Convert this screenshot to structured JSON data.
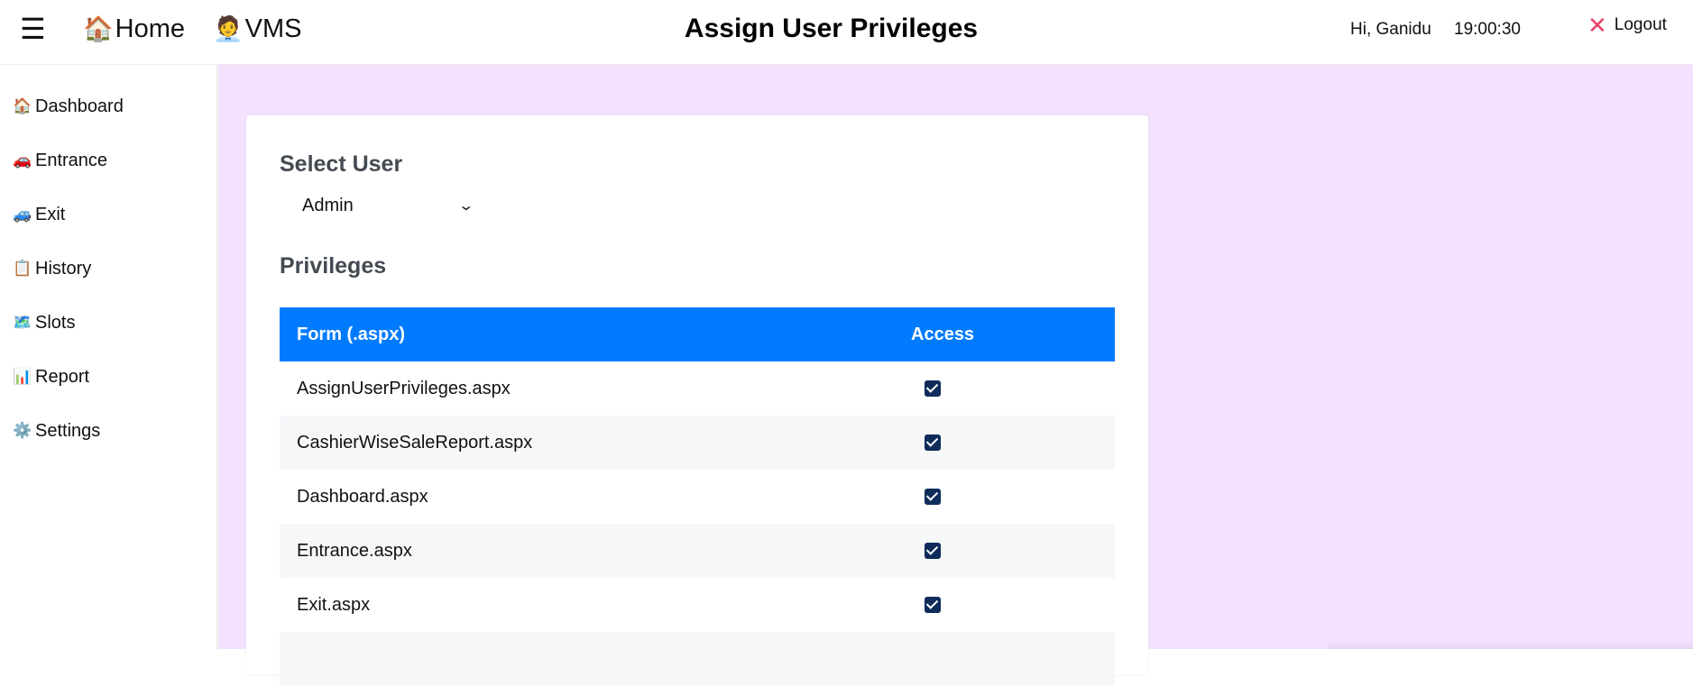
{
  "topbar": {
    "menu_icon": "☰",
    "home_icon": "🏠",
    "home_label": "Home",
    "vms_icon": "🧑‍💼",
    "vms_label": "VMS",
    "title": "Assign User Privileges",
    "greeting": "Hi, Ganidu",
    "clock": "19:00:30",
    "logout_icon": "✕",
    "logout_label": "Logout",
    "logout_icon_color": "#e8426b"
  },
  "sidebar": {
    "items": [
      {
        "icon": "🏠",
        "icon_name": "house-icon",
        "label": "Dashboard"
      },
      {
        "icon": "🚗",
        "icon_name": "car-icon",
        "label": "Entrance"
      },
      {
        "icon": "🚙",
        "icon_name": "suv-icon",
        "label": "Exit"
      },
      {
        "icon": "📋",
        "icon_name": "clipboard-icon",
        "label": "History"
      },
      {
        "icon": "🗺️",
        "icon_name": "map-icon",
        "label": "Slots"
      },
      {
        "icon": "📊",
        "icon_name": "bar-chart-icon",
        "label": "Report"
      },
      {
        "icon": "⚙️",
        "icon_name": "gear-icon",
        "label": "Settings"
      }
    ]
  },
  "main": {
    "background": "#f3e1fe",
    "select_user_title": "Select User",
    "selected_user": "Admin",
    "privileges_title": "Privileges",
    "table": {
      "header_color": "#007bff",
      "columns": [
        "Form (.aspx)",
        "Access"
      ],
      "rows": [
        {
          "form": "AssignUserPrivileges.aspx",
          "access": true
        },
        {
          "form": "CashierWiseSaleReport.aspx",
          "access": true
        },
        {
          "form": "Dashboard.aspx",
          "access": true
        },
        {
          "form": "Entrance.aspx",
          "access": true
        },
        {
          "form": "Exit.aspx",
          "access": true
        }
      ]
    }
  }
}
